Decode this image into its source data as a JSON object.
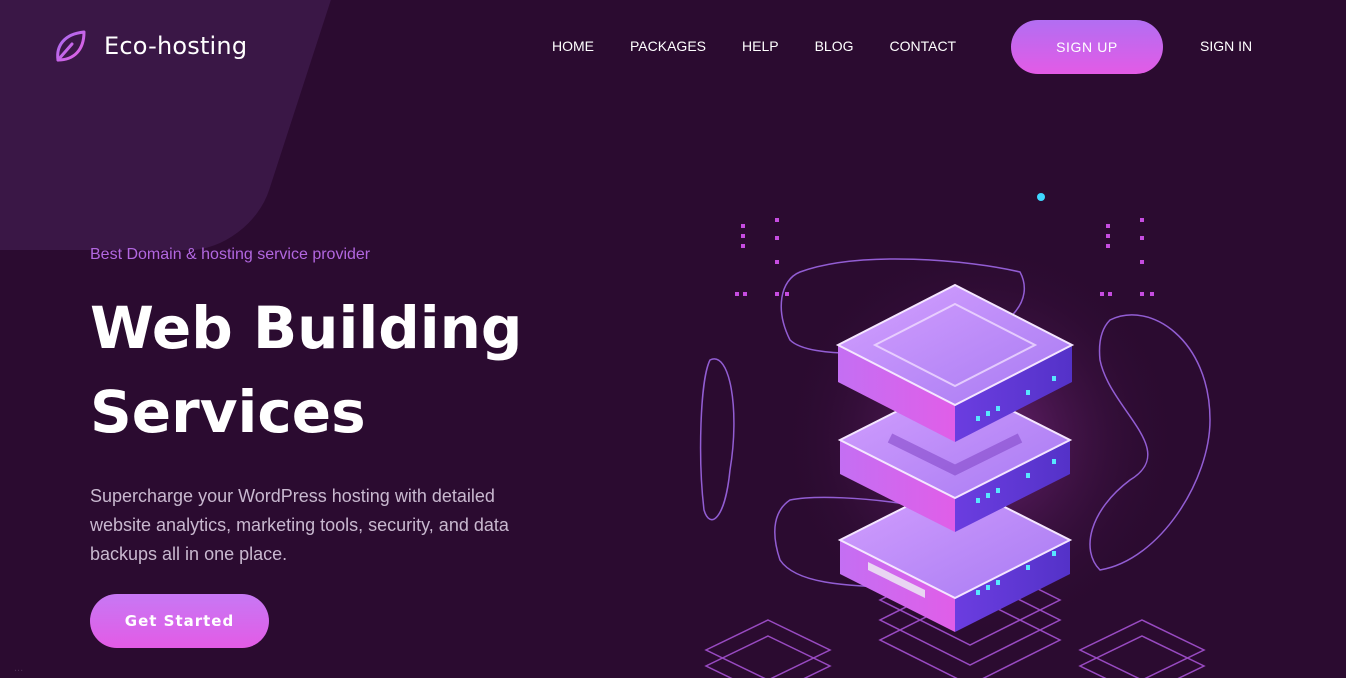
{
  "brand": {
    "name": "Eco-hosting",
    "accent": "#c166ee"
  },
  "nav": {
    "items": [
      "HOME",
      "PACKAGES",
      "HELP",
      "BLOG",
      "CONTACT"
    ],
    "signup_label": "SIGN UP",
    "signin_label": "SIGN IN"
  },
  "hero": {
    "eyebrow": "Best Domain & hosting service provider",
    "title_line1": "Web Building",
    "title_line2": "Services",
    "description": "Supercharge your WordPress hosting with detailed website analytics, marketing tools, security, and data backups all in one place.",
    "cta_label": "Get Started"
  },
  "status_bar": {
    "url": "..."
  },
  "colors": {
    "background": "#2b0b30",
    "button_gradient_start": "#b26ef2",
    "button_gradient_end": "#e35be6",
    "eyebrow": "#b267e0"
  }
}
